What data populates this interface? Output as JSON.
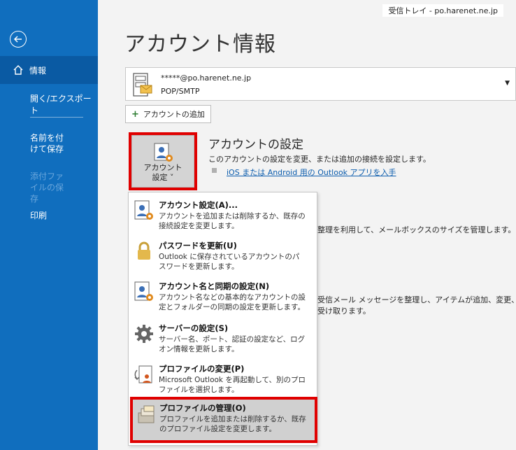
{
  "window": {
    "inbox_label": "受信トレイ - po.harenet.ne.jp"
  },
  "sidebar": {
    "items": [
      {
        "label": "情報"
      },
      {
        "label": "開く/エクスポート"
      },
      {
        "label": "名前を付けて保存"
      },
      {
        "label": "添付ファイルの保存"
      },
      {
        "label": "印刷"
      }
    ]
  },
  "main": {
    "title": "アカウント情報",
    "account": {
      "email": "*****@po.harenet.ne.jp",
      "type": "POP/SMTP"
    },
    "add_account_label": "アカウントの追加",
    "settings_button_label_line1": "アカウント",
    "settings_button_label_line2": "設定 ˅",
    "settings_heading": "アカウントの設定",
    "settings_desc": "このアカウントの設定を変更、または追加の接続を設定します。",
    "settings_link": "iOS または Android 用の Outlook アプリを入手",
    "bg_text_1": "整理を利用して、メールボックスのサイズを管理します。",
    "bg_text_2": "受信メール メッセージを整理し、アイテムが追加、変更、ま",
    "bg_text_3": "受け取ります。"
  },
  "menu": {
    "items": [
      {
        "title": "アカウント設定(A)...",
        "desc": "アカウントを追加または削除するか、既存の接続設定を変更します。"
      },
      {
        "title": "パスワードを更新(U)",
        "desc": "Outlook に保存されているアカウントのパスワードを更新します。"
      },
      {
        "title": "アカウント名と同期の設定(N)",
        "desc": "アカウント名などの基本的なアカウントの設定とフォルダーの同期の設定を更新します。"
      },
      {
        "title": "サーバーの設定(S)",
        "desc": "サーバー名、ポート、認証の設定など、ログオン情報を更新します。"
      },
      {
        "title": "プロファイルの変更(P)",
        "desc": "Microsoft Outlook を再起動して、別のプロファイルを選択します。"
      },
      {
        "title": "プロファイルの管理(O)",
        "desc": "プロファイルを追加または削除するか、既存のプロファイル設定を変更します。"
      }
    ]
  },
  "colors": {
    "sidebar": "#106ebe",
    "sidebar_active": "#0a5aa3",
    "highlight": "#e00000",
    "link": "#0b5cad"
  }
}
